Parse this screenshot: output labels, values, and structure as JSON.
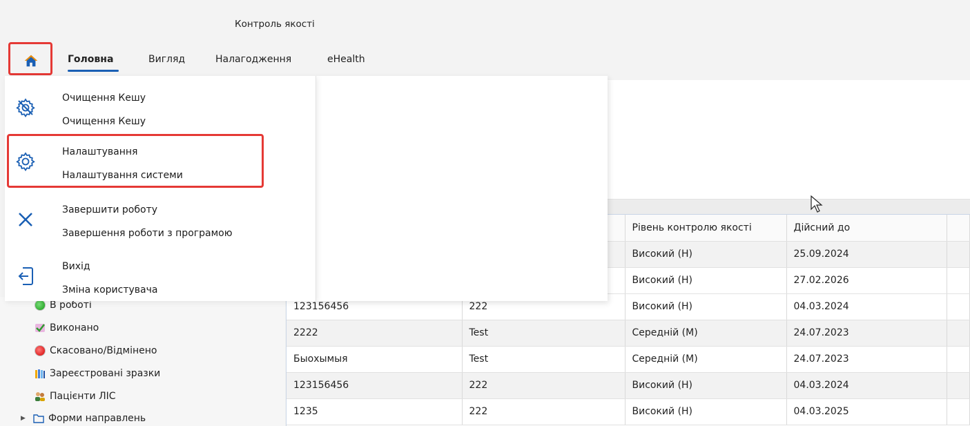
{
  "window": {
    "title": "Контроль якості"
  },
  "ribbon": {
    "home_icon": "home-icon",
    "tabs": [
      {
        "label": "Головна",
        "active": true
      },
      {
        "label": "Вигляд",
        "active": false
      },
      {
        "label": "Налагодження",
        "active": false
      },
      {
        "label": "eHealth",
        "active": false
      }
    ]
  },
  "menu": {
    "items": [
      {
        "icon": "cache-gear-icon",
        "title": "Очищення Кешу",
        "subtitle": "Очищення Кешу"
      },
      {
        "icon": "settings-gear-icon",
        "title": "Налаштування",
        "subtitle": "Налаштування системи"
      },
      {
        "icon": "close-icon",
        "title": "Завершити роботу",
        "subtitle": "Завершення роботи з програмою"
      },
      {
        "icon": "logout-icon",
        "title": "Вихід",
        "subtitle": "Зміна користувача"
      }
    ]
  },
  "tree": {
    "items": [
      {
        "label": "В роботі",
        "icon": "green-dot-icon"
      },
      {
        "label": "Виконано",
        "icon": "checked-icon"
      },
      {
        "label": "Скасовано/Відмінено",
        "icon": "red-dot-icon"
      },
      {
        "label": "Зареєстровані зразки",
        "icon": "test-tubes-icon"
      },
      {
        "label": "Пацієнти ЛІС",
        "icon": "patients-icon"
      },
      {
        "label": "Форми направлень",
        "icon": "folder-icon"
      }
    ]
  },
  "table": {
    "headers": [
      "",
      "",
      "Рівень контролю якості",
      "Дійсний до"
    ],
    "rows": [
      [
        "",
        "",
        "Високий (H)",
        "25.09.2024"
      ],
      [
        "",
        "",
        "Високий (H)",
        "27.02.2026"
      ],
      [
        "123156456",
        "222",
        "Високий (H)",
        "04.03.2024"
      ],
      [
        "2222",
        "Test",
        "Середній (M)",
        "24.07.2023"
      ],
      [
        "Быохымыя",
        "Test",
        "Середній (M)",
        "24.07.2023"
      ],
      [
        "123156456",
        "222",
        "Високий (H)",
        "04.03.2024"
      ],
      [
        "1235",
        "222",
        "Високий (H)",
        "04.03.2025"
      ]
    ]
  },
  "colors": {
    "highlight": "#e53935",
    "accent": "#1a5fb4",
    "menu_icon": "#1a5fb4"
  }
}
